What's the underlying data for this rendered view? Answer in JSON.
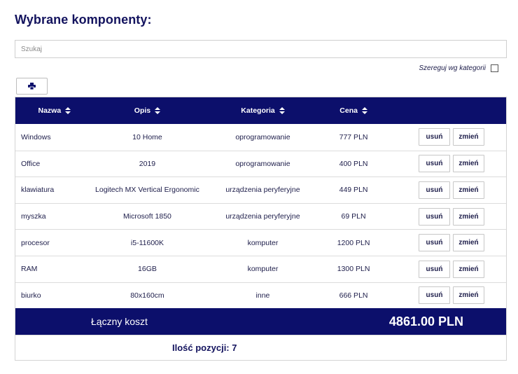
{
  "page": {
    "title": "Wybrane komponenty:"
  },
  "search": {
    "placeholder": "Szukaj",
    "value": ""
  },
  "sort_toggle": {
    "label": "Szereguj wg kategorii",
    "checked": false
  },
  "print_button": {
    "icon": "printer-icon"
  },
  "table": {
    "columns": [
      "Nazwa",
      "Opis",
      "Kategoria",
      "Cena"
    ],
    "rows": [
      {
        "name": "Windows",
        "desc": "10 Home",
        "category": "oprogramowanie",
        "price": "777 PLN"
      },
      {
        "name": "Office",
        "desc": "2019",
        "category": "oprogramowanie",
        "price": "400 PLN"
      },
      {
        "name": "klawiatura",
        "desc": "Logitech MX Vertical Ergonomic",
        "category": "urządzenia peryferyjne",
        "price": "449 PLN"
      },
      {
        "name": "myszka",
        "desc": "Microsoft 1850",
        "category": "urządzenia peryferyjne",
        "price": "69 PLN"
      },
      {
        "name": "procesor",
        "desc": "i5-11600K",
        "category": "komputer",
        "price": "1200 PLN"
      },
      {
        "name": "RAM",
        "desc": "16GB",
        "category": "komputer",
        "price": "1300 PLN"
      },
      {
        "name": "biurko",
        "desc": "80x160cm",
        "category": "inne",
        "price": "666 PLN"
      }
    ],
    "remove_label": "usuń",
    "edit_label": "zmień"
  },
  "summary": {
    "total_label": "Łączny koszt",
    "total_value": "4861.00 PLN",
    "count_label": "Ilość pozycji: 7"
  },
  "colors": {
    "header_bg": "#0c0f6b",
    "title": "#13135e"
  }
}
